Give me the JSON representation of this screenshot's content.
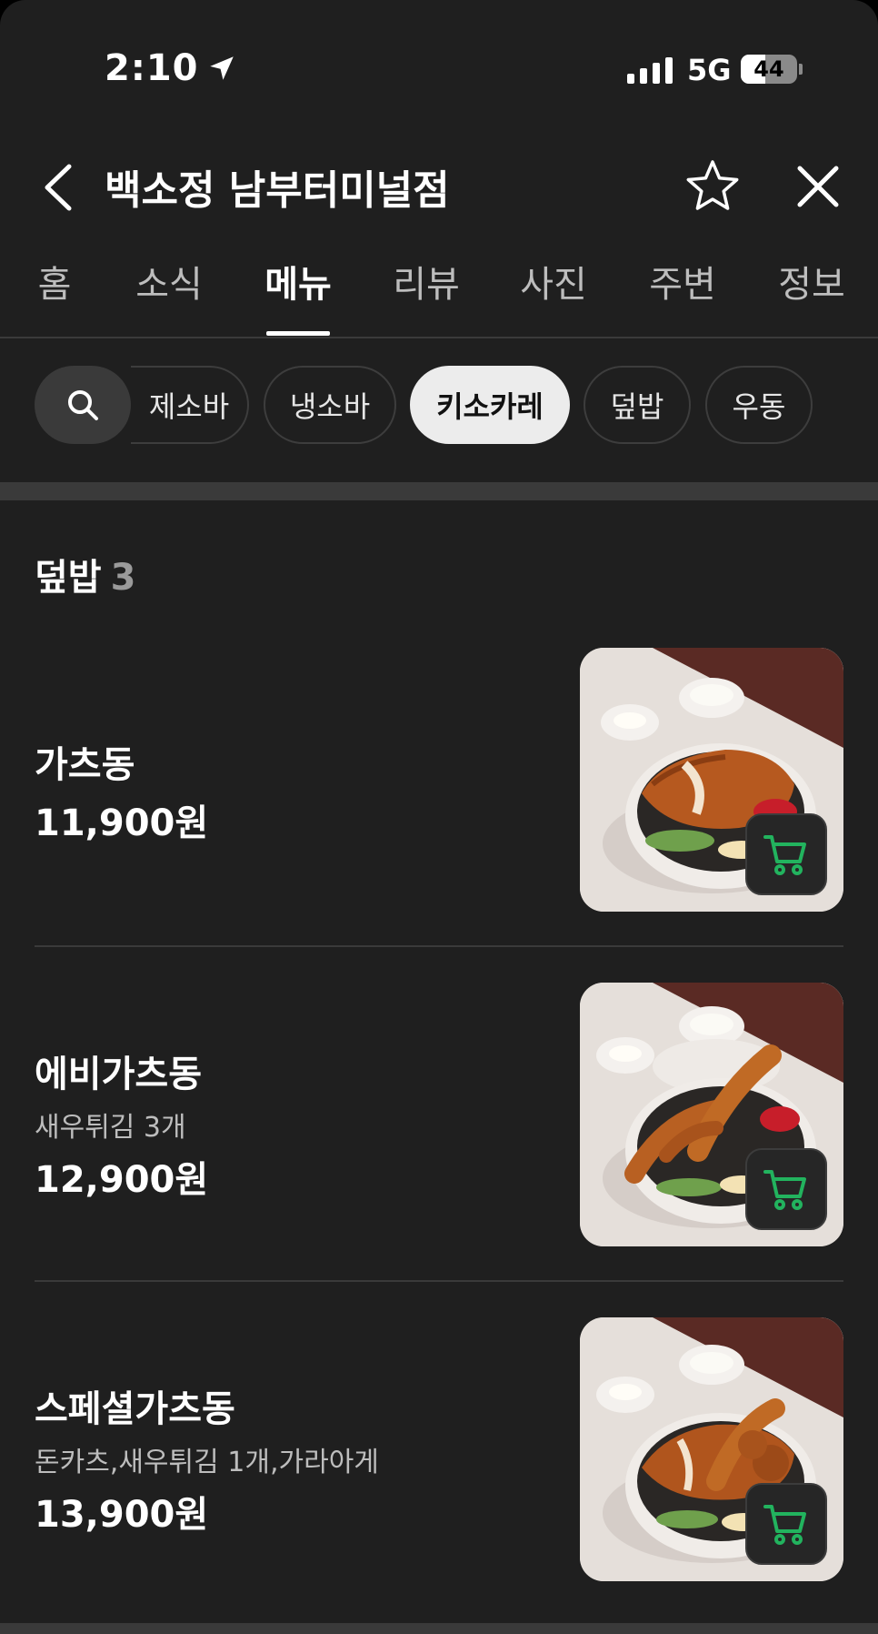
{
  "status_bar": {
    "time": "2:10",
    "network": "5G",
    "battery": "44",
    "battery_level": 0.44
  },
  "header": {
    "title": "백소정 남부터미널점"
  },
  "tabs": [
    {
      "label": "홈",
      "active": false
    },
    {
      "label": "소식",
      "active": false
    },
    {
      "label": "메뉴",
      "active": true
    },
    {
      "label": "리뷰",
      "active": false
    },
    {
      "label": "사진",
      "active": false
    },
    {
      "label": "주변",
      "active": false
    },
    {
      "label": "정보",
      "active": false
    }
  ],
  "chips": [
    {
      "label": "제소바",
      "selected": false
    },
    {
      "label": "냉소바",
      "selected": false
    },
    {
      "label": "키소카레",
      "selected": true
    },
    {
      "label": "덮밥",
      "selected": false
    },
    {
      "label": "우동",
      "selected": false
    }
  ],
  "section": {
    "title": "덮밥",
    "count": "3"
  },
  "items": [
    {
      "name": "가츠동",
      "desc": "",
      "price": "11,900원",
      "image": "katsudon-photo"
    },
    {
      "name": "에비가츠동",
      "desc": "새우튀김 3개",
      "price": "12,900원",
      "image": "ebi-katsudon-photo"
    },
    {
      "name": "스페셜가츠동",
      "desc": "돈카츠,새우튀김 1개,가라아게",
      "price": "13,900원",
      "image": "special-katsudon-photo"
    }
  ],
  "colors": {
    "background": "#1f1f1f",
    "cart_icon": "#22b35e",
    "selected_chip": "#ececec"
  }
}
